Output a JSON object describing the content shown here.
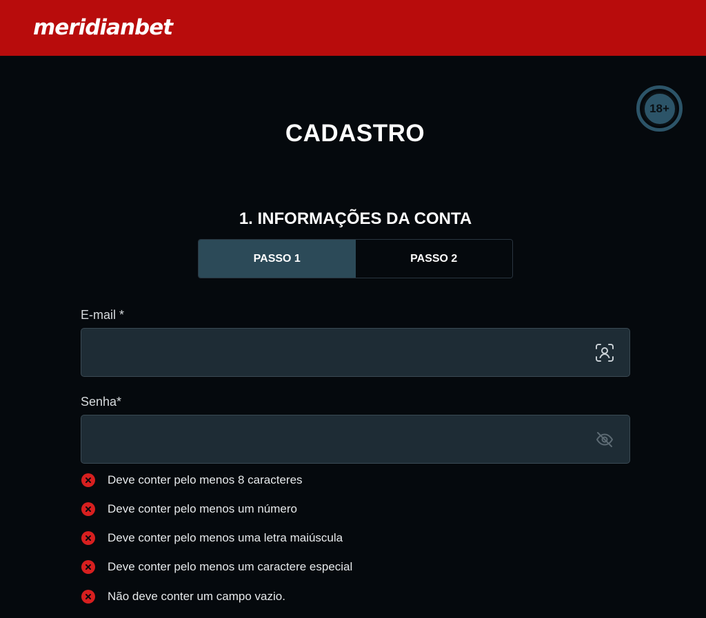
{
  "header": {
    "logo_text": "meridianbet",
    "brand_color": "#b80c0c"
  },
  "age_badge": {
    "label": "18+"
  },
  "page": {
    "title": "CADASTRO"
  },
  "section": {
    "title": "1. INFORMAÇÕES DA CONTA"
  },
  "steps": [
    {
      "label": "PASSO 1",
      "active": true
    },
    {
      "label": "PASSO 2",
      "active": false
    }
  ],
  "form": {
    "email": {
      "label": "E-mail *",
      "value": "",
      "placeholder": "",
      "icon": "face-scan-icon"
    },
    "password": {
      "label": "Senha*",
      "value": "",
      "placeholder": "",
      "icon": "eye-off-icon"
    }
  },
  "password_rules": [
    {
      "text": "Deve conter pelo menos 8 caracteres",
      "status": "invalid"
    },
    {
      "text": "Deve conter pelo menos um número",
      "status": "invalid"
    },
    {
      "text": "Deve conter pelo menos uma letra maiúscula",
      "status": "invalid"
    },
    {
      "text": "Deve conter pelo menos um caractere especial",
      "status": "invalid"
    },
    {
      "text": "Não deve conter um campo vazio.",
      "status": "invalid"
    }
  ],
  "colors": {
    "background": "#05090d",
    "input_bg": "#1e2c35",
    "active_step": "#2c4a58",
    "error": "#d71f1f"
  }
}
